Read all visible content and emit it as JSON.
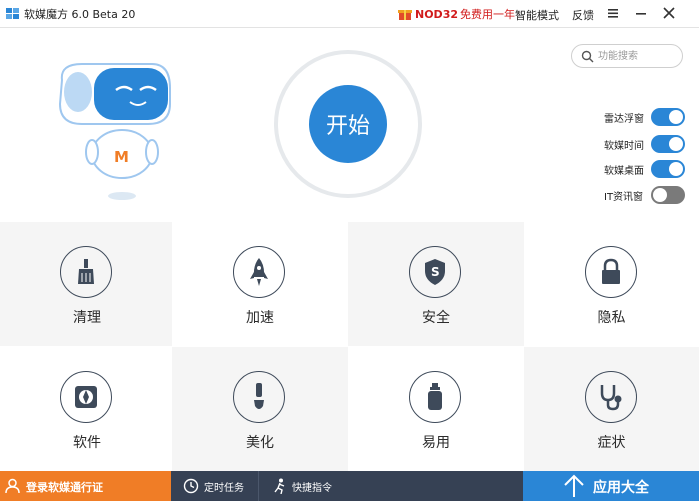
{
  "titlebar": {
    "app_title": "软媒魔方 6.0 Beta 20",
    "promo_brand": "NOD32",
    "promo_text": "免费用一年",
    "menu_smart_mode": "智能模式",
    "menu_feedback": "反馈"
  },
  "main": {
    "start_label": "开始",
    "search_placeholder": "功能搜索"
  },
  "toggles": [
    {
      "label": "雷达浮窗",
      "state": "on"
    },
    {
      "label": "软媒时间",
      "state": "on"
    },
    {
      "label": "软媒桌面",
      "state": "on"
    },
    {
      "label": "IT资讯窗",
      "state": "off"
    }
  ],
  "tiles": [
    {
      "label": "清理",
      "icon": "broom-icon"
    },
    {
      "label": "加速",
      "icon": "rocket-icon"
    },
    {
      "label": "安全",
      "icon": "shield-icon"
    },
    {
      "label": "隐私",
      "icon": "lock-icon"
    },
    {
      "label": "软件",
      "icon": "aperture-icon"
    },
    {
      "label": "美化",
      "icon": "brush-icon"
    },
    {
      "label": "易用",
      "icon": "bottle-icon"
    },
    {
      "label": "症状",
      "icon": "stethoscope-icon"
    }
  ],
  "bottom": {
    "login_label": "登录软媒通行证",
    "timer_label": "定时任务",
    "shortcut_label": "快捷指令",
    "apps_label": "应用大全"
  },
  "colors": {
    "accent_blue": "#2a86d6",
    "login_orange": "#f07d26",
    "bar_dark": "#364154",
    "promo_red": "#d11b1b",
    "tile_light": "#f5f5f5"
  }
}
